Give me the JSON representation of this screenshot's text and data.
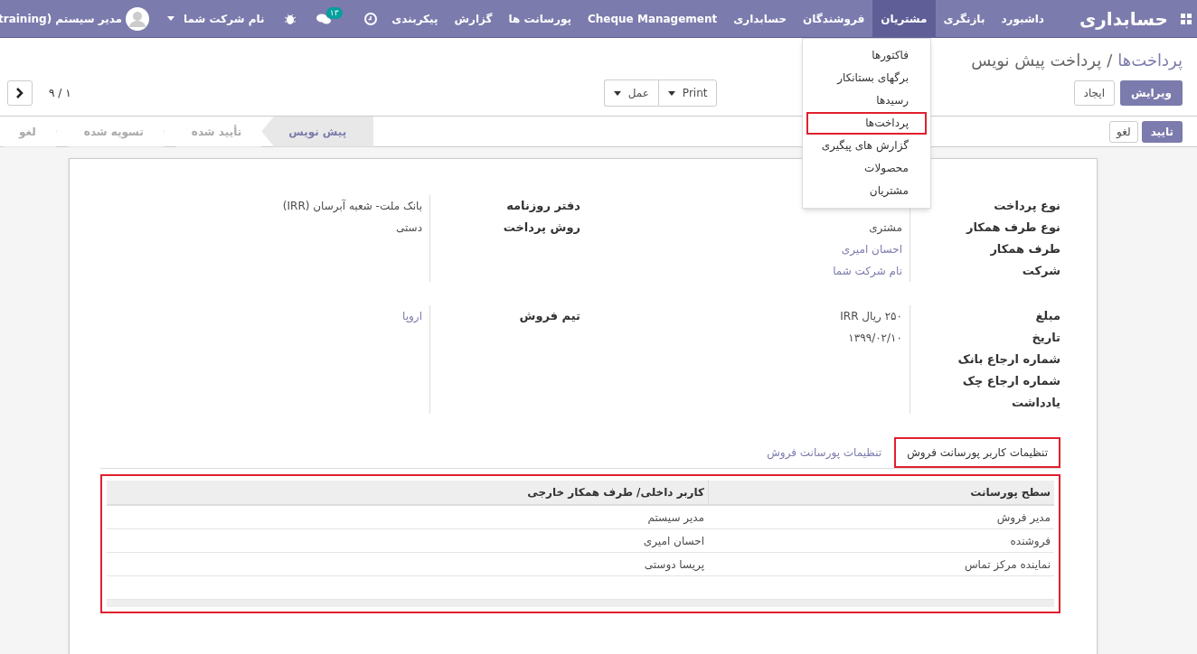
{
  "navbar": {
    "brand": "حسابداری",
    "menu": [
      {
        "label": "داشبورد",
        "selected": false
      },
      {
        "label": "بازنگری",
        "selected": false
      },
      {
        "label": "مشتریان",
        "selected": true
      },
      {
        "label": "فروشندگان",
        "selected": false
      },
      {
        "label": "حسابداری",
        "selected": false
      },
      {
        "label": "Cheque Management",
        "selected": false
      },
      {
        "label": "پورسانت ها",
        "selected": false
      },
      {
        "label": "گزارش",
        "selected": false
      },
      {
        "label": "پیکربندی",
        "selected": false
      }
    ],
    "chat_count": "۱۳",
    "company": "نام شرکت شما",
    "user": "مدیر سیستم (training"
  },
  "dropdown": [
    {
      "label": "فاکتورها",
      "highlighted": false
    },
    {
      "label": "برگهای بستانکار",
      "highlighted": false
    },
    {
      "label": "رسیدها",
      "highlighted": false
    },
    {
      "label": "پرداخت‌ها",
      "highlighted": true
    },
    {
      "label": "گزارش های پیگیری",
      "highlighted": false
    },
    {
      "label": "محصولات",
      "highlighted": false
    },
    {
      "label": "مشتریان",
      "highlighted": false
    }
  ],
  "breadcrumb": {
    "parent": "پرداخت‌ها",
    "separator": "/",
    "current": "پرداخت پیش نویس"
  },
  "buttons": {
    "edit": "ویرایش",
    "create": "ایجاد",
    "print": "Print",
    "action": "عمل"
  },
  "pager": {
    "text": "۱ / ۹"
  },
  "status_buttons": {
    "confirm": "تایید",
    "cancel": "لغو"
  },
  "stages": [
    {
      "label": "پیش نویس",
      "selected": true
    },
    {
      "label": "تأیید شده",
      "selected": false
    },
    {
      "label": "تسویه شده",
      "selected": false
    },
    {
      "label": "لغو",
      "selected": false
    }
  ],
  "groups": [
    {
      "right": [
        {
          "label": "نوع پرداخت"
        },
        {
          "label": "نوع طرف همکار",
          "value": "مشتری",
          "link": false
        },
        {
          "label": "طرف همکار",
          "value": "احسان امیری",
          "link": true
        },
        {
          "label": "شرکت",
          "value": "نام شرکت شما",
          "link": true
        }
      ],
      "left": [
        {
          "label": "دفتر روزنامه",
          "value": "بانک ملت- شعبه آبرسان (IRR)",
          "link": false
        },
        {
          "label": "روش پرداخت",
          "value": "دستی",
          "link": false
        }
      ]
    },
    {
      "right": [
        {
          "label": "مبلغ",
          "value": "۲۵۰ ریال IRR",
          "link": false
        },
        {
          "label": "تاریخ",
          "value": "۱۳۹۹/۰۲/۱۰",
          "link": false
        },
        {
          "label": "شماره ارجاع بانک"
        },
        {
          "label": "شماره ارجاع چک"
        },
        {
          "label": "یادداشت"
        }
      ],
      "left": [
        {
          "label": "تیم فروش",
          "value": "اروپا",
          "link": true
        }
      ]
    }
  ],
  "tabs": [
    {
      "label": "تنظیمات کاربر پورسانت فروش",
      "selected": true,
      "highlighted": true
    },
    {
      "label": "تنظیمات پورسانت فروش",
      "selected": false,
      "highlighted": false
    }
  ],
  "table": {
    "highlighted": true,
    "columns": [
      "سطح پورسانت",
      "کاربر داخلی/ طرف همکار خارجی"
    ],
    "rows": [
      [
        "مدیر فروش",
        "مدیر سیستم"
      ],
      [
        "فروشنده",
        "احسان امیری"
      ],
      [
        "نماینده مرکز تماس",
        "پریسا دوستی"
      ]
    ]
  }
}
